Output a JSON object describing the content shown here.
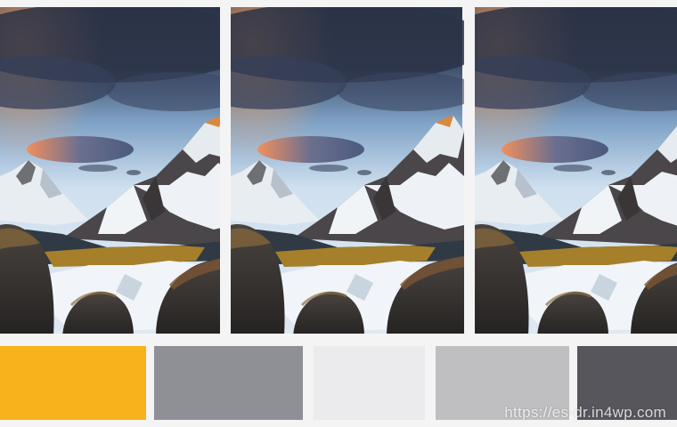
{
  "panels": [
    {
      "name": "landscape-panel-1"
    },
    {
      "name": "landscape-panel-2"
    },
    {
      "name": "landscape-panel-3"
    }
  ],
  "palette": {
    "swatches": [
      "#f7b21c",
      "#8f9096",
      "#ebebed",
      "#bfbfc1",
      "#56565c"
    ]
  },
  "colors": {
    "sky_top": "#2d3a52",
    "sky_mid": "#6f8fb3",
    "sky_low": "#c9dcee",
    "cloud_orange": "#e58a5c",
    "snow": "#eef2f6",
    "rock_dark": "#2e2c2b",
    "rock_mid": "#5b534b",
    "valley_gold": "#a57f2a"
  },
  "watermark": {
    "text": "https://es-dr.in4wp.com"
  }
}
